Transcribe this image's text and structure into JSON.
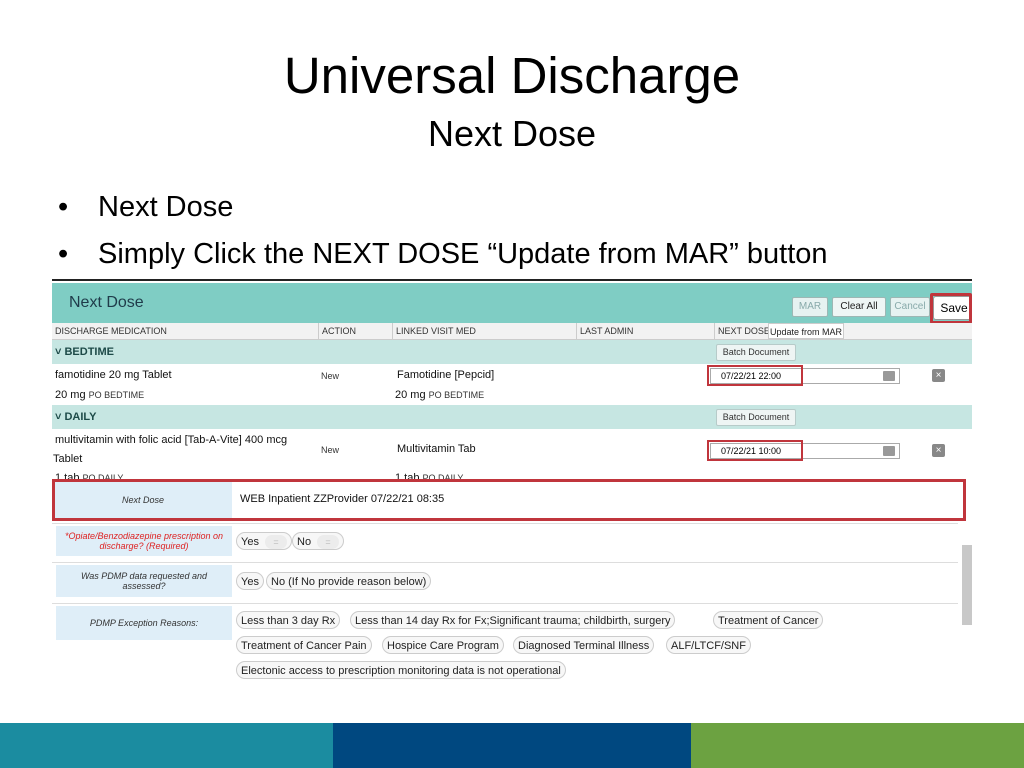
{
  "slide": {
    "title": "Universal Discharge",
    "subtitle": "Next Dose",
    "bullets": [
      "Next Dose",
      "Simply Click the NEXT DOSE “Update from MAR” button"
    ],
    "bullet_symbol": "•"
  },
  "app": {
    "header": {
      "title": "Next Dose",
      "buttons": {
        "mar": "MAR",
        "clear_all": "Clear All",
        "cancel": "Cancel",
        "save": "Save"
      }
    },
    "columns": [
      "DISCHARGE MEDICATION",
      "ACTION",
      "LINKED VISIT MED",
      "LAST ADMIN",
      "NEXT DOSE"
    ],
    "update_from_mar": "Update from MAR",
    "groups": [
      {
        "name": "˅ BEDTIME",
        "batch_label": "Batch Document",
        "med_name": "famotidine 20 mg Tablet",
        "med_dose": "20 mg",
        "med_route": "PO BEDTIME",
        "action": "New",
        "linked_name": "Famotidine [Pepcid]",
        "linked_dose": "20 mg",
        "linked_route": "PO BEDTIME",
        "next_dose": "07/22/21 22:00"
      },
      {
        "name": "˅ DAILY",
        "batch_label": "Batch Document",
        "med_name": "multivitamin with folic acid [Tab-A-Vite] 400 mcg",
        "med_name2": "Tablet",
        "med_dose": "1 tab",
        "med_route": "PO DAILY",
        "action": "New",
        "linked_name": "Multivitamin Tab",
        "linked_dose": "1 tab",
        "linked_route": "PO DAILY",
        "next_dose": "07/22/21 10:00"
      }
    ],
    "clear_icon": "×",
    "next_dose_row": {
      "label": "Next Dose",
      "value": "WEB Inpatient ZZProvider 07/22/21 08:35"
    },
    "questions": [
      {
        "label": "*Opiate/Benzodiazepine prescription on discharge? (Required)",
        "options": [
          "Yes",
          "No"
        ],
        "comment_icon": "="
      },
      {
        "label": "Was PDMP data requested and assessed?",
        "options": [
          "Yes",
          "No (If No provide reason below)"
        ]
      },
      {
        "label": "PDMP Exception Reasons:",
        "options": [
          "Less than 3 day Rx",
          "Less than 14 day Rx for Fx;Significant trauma; childbirth, surgery",
          "Treatment of Cancer",
          "Treatment of Cancer Pain",
          "Hospice Care Program",
          "Diagnosed Terminal Illness",
          "ALF/LTCF/SNF",
          "Electonic access to prescription monitoring data is not operational"
        ]
      }
    ]
  },
  "colors": {
    "header_teal": "#7fcdc4",
    "group_teal": "#c6e6e2",
    "highlight_red": "#c0353c",
    "footer": [
      "#1b8ca0",
      "#004880",
      "#6ca241"
    ]
  }
}
